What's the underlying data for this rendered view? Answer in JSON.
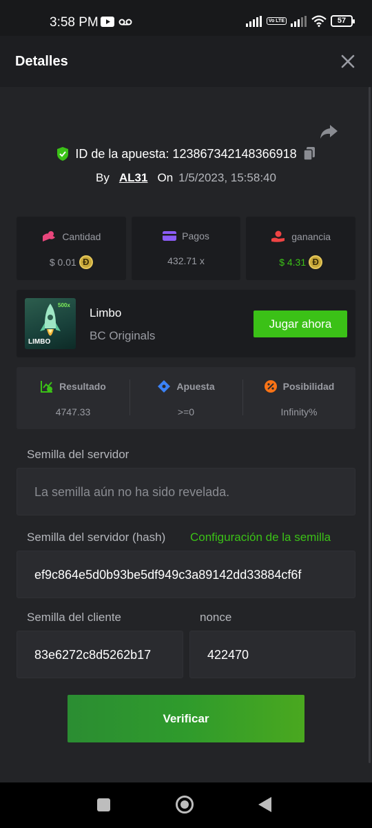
{
  "status_bar": {
    "time": "3:58 PM",
    "battery": "57",
    "lte": "Vo LTE",
    "icons": [
      "youtube-icon",
      "voicemail-icon",
      "signal-icon",
      "lte-icon",
      "signal-icon",
      "wifi-icon",
      "battery-icon"
    ]
  },
  "header": {
    "title": "Detalles",
    "close_icon": "close-icon"
  },
  "bet": {
    "id_label": "ID de la apuesta: 123867342148366918",
    "by_label": "By",
    "user": "AL31",
    "on_label": "On",
    "datetime": "1/5/2023, 15:58:40",
    "icons": [
      "shield-check-icon",
      "copy-icon",
      "share-icon"
    ]
  },
  "stats": [
    {
      "label": "Cantidad",
      "value": "$ 0.01",
      "coin": "Ð",
      "icon": "coins-icon",
      "icon_color": "#e8467c"
    },
    {
      "label": "Pagos",
      "value": "432.71 x",
      "icon": "wallet-icon",
      "icon_color": "#8b5cf6"
    },
    {
      "label": "ganancia",
      "value": "$ 4.31",
      "coin": "Ð",
      "icon": "hand-coin-icon",
      "icon_color": "#ef4444"
    }
  ],
  "game": {
    "name": "Limbo",
    "provider": "BC Originals",
    "play_label": "Jugar ahora",
    "thumb_text": "LIMBO",
    "thumb_badge": "500x"
  },
  "result": [
    {
      "label": "Resultado",
      "value": "4747.33",
      "icon": "chart-check-icon",
      "icon_color": "#3bc117"
    },
    {
      "label": "Apuesta",
      "value": ">=0",
      "icon": "ticket-icon",
      "icon_color": "#3b82f6"
    },
    {
      "label": "Posibilidad",
      "value": "Infinity%",
      "icon": "percent-icon",
      "icon_color": "#f97316"
    }
  ],
  "server_seed": {
    "label": "Semilla del servidor",
    "placeholder": "La semilla aún no ha sido revelada."
  },
  "server_hash": {
    "label": "Semilla del servidor (hash)",
    "config_link": "Configuración de la semilla",
    "value": "ef9c864e5d0b93be5df949c3a89142dd33884cf6f"
  },
  "client_seed": {
    "label": "Semilla del cliente",
    "value": "83e6272c8d5262b17"
  },
  "nonce": {
    "label": "nonce",
    "value": "422470"
  },
  "verify_label": "Verificar",
  "colors": {
    "accent_green": "#3bc117",
    "background": "#232427",
    "card": "#1b1c1f"
  }
}
